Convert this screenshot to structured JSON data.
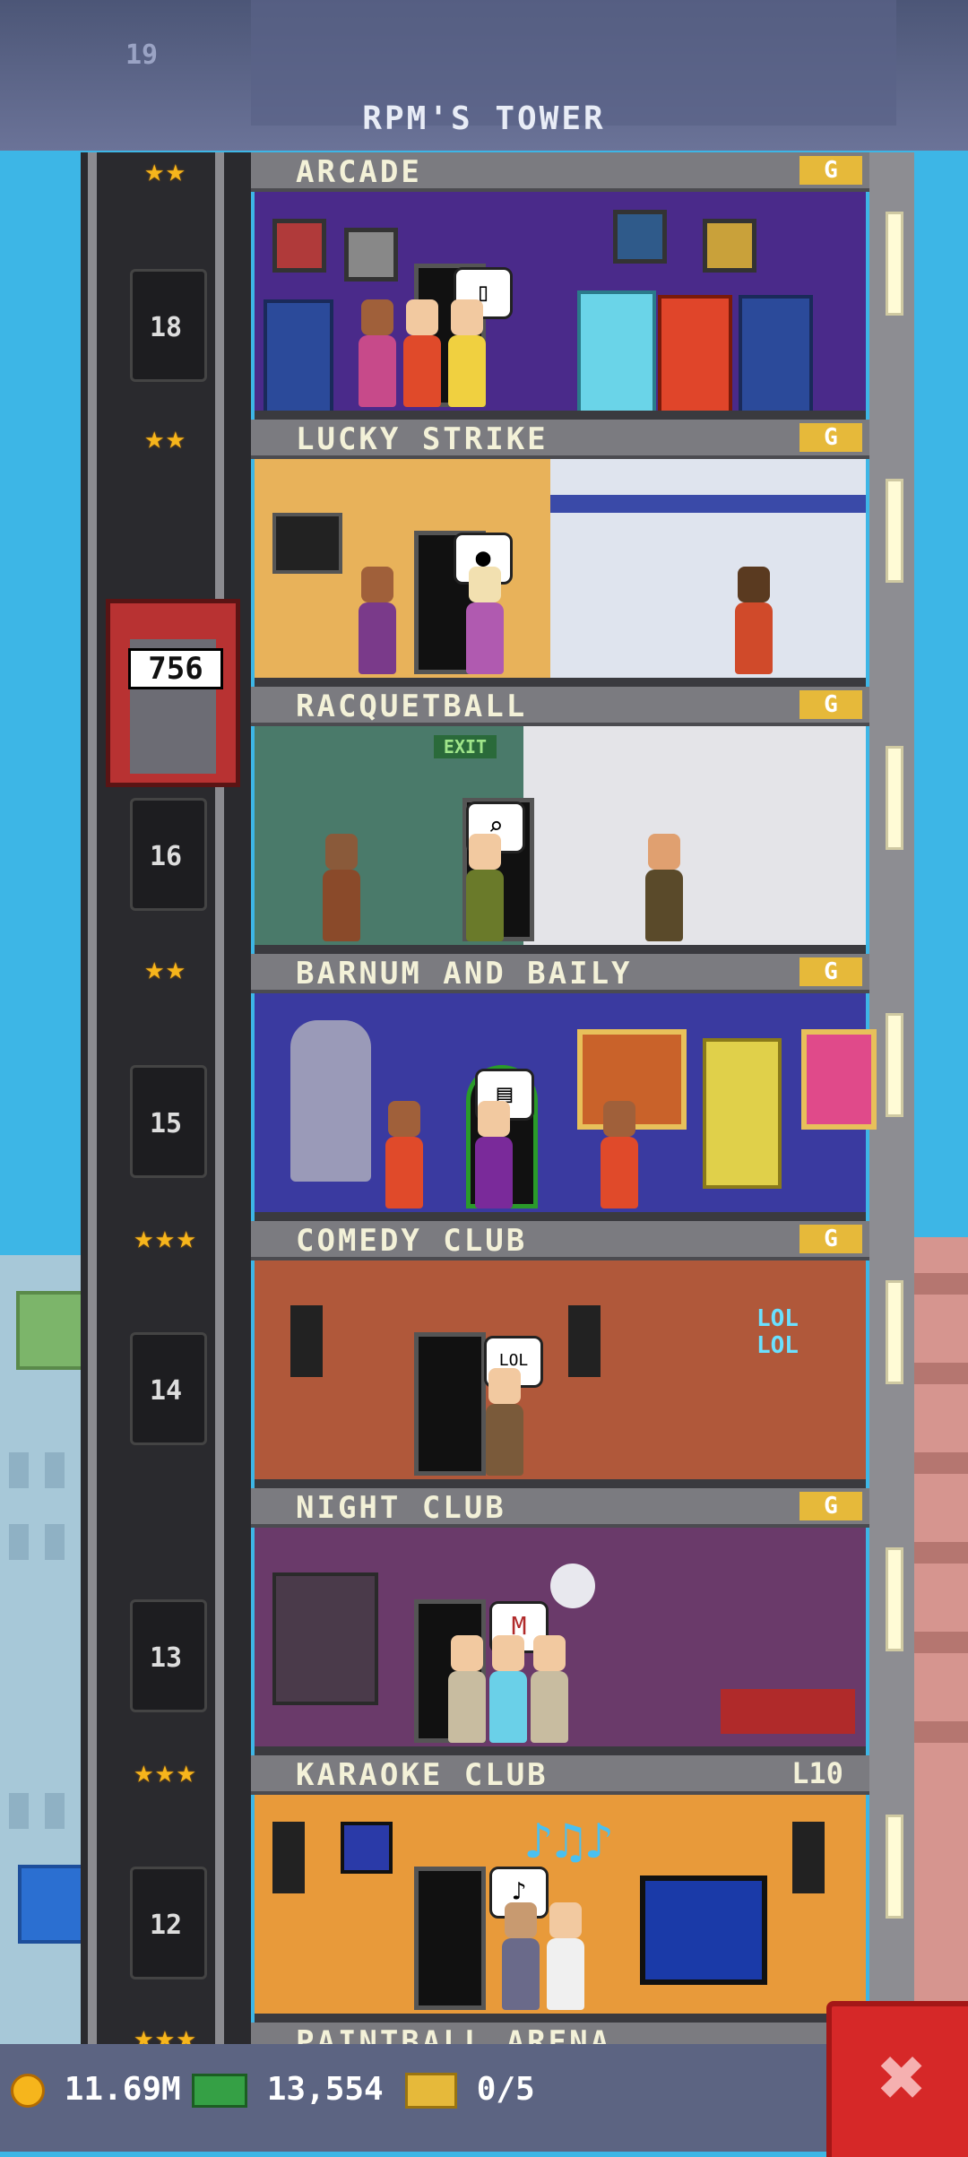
{
  "header": {
    "title": "RPM'S TOWER",
    "ghost_floor_number": "19"
  },
  "shaft": {
    "floor_numbers": [
      "18",
      "16",
      "15",
      "14",
      "13",
      "12"
    ],
    "elevator_counter": "756"
  },
  "floors": [
    {
      "name": "ARCADE",
      "badge": "G",
      "bubble": "▯"
    },
    {
      "name": "LUCKY STRIKE",
      "badge": "G",
      "bubble": "●"
    },
    {
      "name": "RACQUETBALL",
      "badge": "G",
      "bubble": "⌕",
      "sign": "EXIT"
    },
    {
      "name": "BARNUM AND BAILY",
      "badge": "G",
      "bubble": "▤"
    },
    {
      "name": "COMEDY CLUB",
      "badge": "G",
      "bubble": "LOL",
      "neon": "LOL LOL"
    },
    {
      "name": "NIGHT CLUB",
      "badge": "G",
      "bubble": "M"
    },
    {
      "name": "KARAOKE CLUB",
      "badge": "L10",
      "bubble": "♪",
      "notes": "♪♫♪"
    },
    {
      "name": "PAINTBALL ARENA",
      "badge": "G"
    }
  ],
  "coins_indicator": {
    "two": "★★",
    "three": "★★★"
  },
  "bottom_bar": {
    "coins": "11.69M",
    "bux": "13,554",
    "tickets": "0/5",
    "close_symbol": "✖"
  },
  "colors": {
    "sky": "#3db6e6",
    "badge_gold": "#e6b93a",
    "close_red": "#d62828"
  }
}
